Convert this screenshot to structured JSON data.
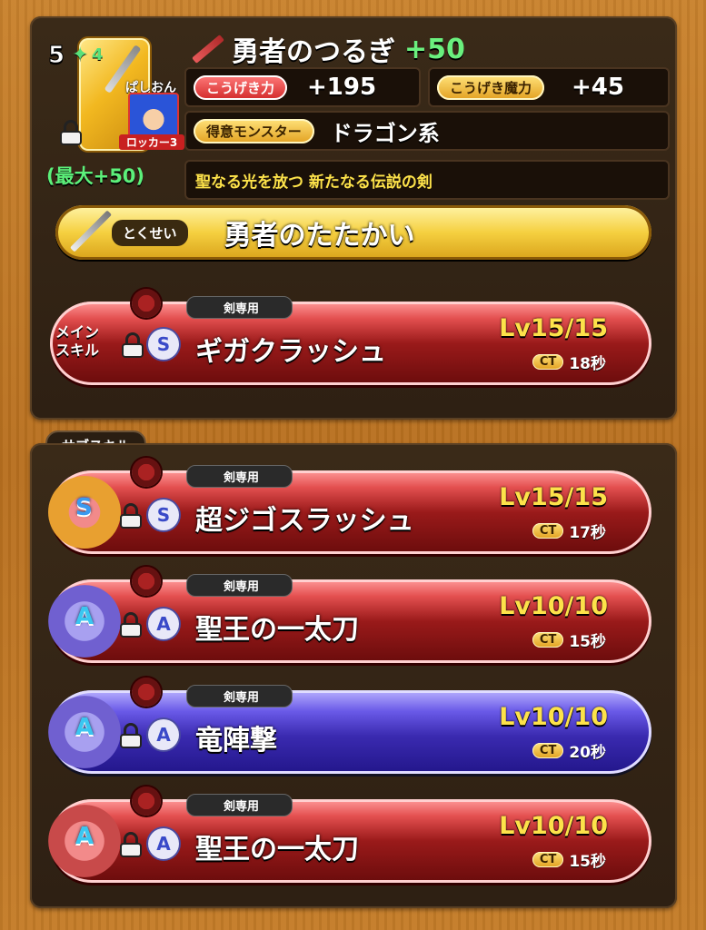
{
  "weapon": {
    "name": "勇者のつるぎ",
    "plus": "+50",
    "rank": "5",
    "rank_star": "✦",
    "rank_sub": "4",
    "max_text": "(最大+50)",
    "locker_name": "ぱしおん",
    "locker_label": "ロッカー3"
  },
  "stats": {
    "attack_label": "こうげき力",
    "attack_value": "+195",
    "magic_label": "こうげき魔力",
    "magic_value": "+45",
    "monster_label": "得意モンスター",
    "monster_value": "ドラゴン系",
    "description": "聖なる光を放つ 新たなる伝説の剣"
  },
  "trait": {
    "label": "とくせい",
    "name": "勇者のたたかい"
  },
  "main_skill": {
    "section_label_line1": "メイン",
    "section_label_line2": "スキル",
    "tag": "剣専用",
    "rank": "S",
    "name": "ギガクラッシュ",
    "level": "Lv15/15",
    "ct_label": "CT",
    "ct_value": "18秒"
  },
  "sub_header": "サブスキル",
  "sub_skills": [
    {
      "tag": "剣専用",
      "rank": "S",
      "badge": "S",
      "name": "超ジゴスラッシュ",
      "level": "Lv15/15",
      "ct_label": "CT",
      "ct_value": "17秒"
    },
    {
      "tag": "剣専用",
      "rank": "A",
      "badge": "A",
      "name": "聖王の一太刀",
      "level": "Lv10/10",
      "ct_label": "CT",
      "ct_value": "15秒"
    },
    {
      "tag": "剣専用",
      "rank": "A",
      "badge": "A",
      "name": "竜陣撃",
      "level": "Lv10/10",
      "ct_label": "CT",
      "ct_value": "20秒"
    },
    {
      "tag": "剣専用",
      "rank": "A",
      "badge": "A",
      "name": "聖王の一太刀",
      "level": "Lv10/10",
      "ct_label": "CT",
      "ct_value": "15秒"
    }
  ],
  "colors": {
    "accent_green": "#5cf07a",
    "accent_gold": "#fde24a",
    "skill_red": "#9a1a1a",
    "skill_blue": "#3a2ab0"
  }
}
